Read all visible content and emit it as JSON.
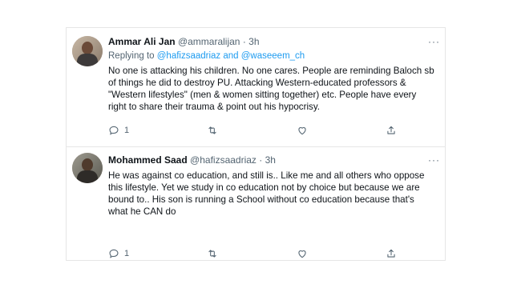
{
  "tweets": [
    {
      "name": "Ammar Ali Jan",
      "handle": "@ammaralijan",
      "dot": "·",
      "time": "3h",
      "reply_prefix": "Replying to",
      "reply_users": "@hafizsaadriaz and @waseeem_ch",
      "text": "No one is attacking his children. No one cares. People are reminding Baloch sb of things he did to destroy PU. Attacking Western-educated professors & \"Western lifestyles\" (men & women sitting together) etc. People have every right to share their trauma & point out his hypocrisy.",
      "reply_count": "1",
      "more": "···",
      "icons": [
        "reply-icon",
        "retweet-icon",
        "like-icon",
        "share-icon"
      ]
    },
    {
      "name": "Mohammed Saad",
      "handle": "@hafizsaadriaz",
      "dot": "·",
      "time": "3h",
      "text": "He was against co education, and still is.. Like me and all others who oppose this lifestyle. Yet we study in co education not by choice but because we are bound to.. His son is running a School without co education because that's what he CAN do",
      "reply_count": "1",
      "more": "···",
      "icons": [
        "reply-icon",
        "retweet-icon",
        "like-icon",
        "share-icon"
      ]
    }
  ],
  "colors": {
    "link": "#1d9bf0",
    "muted": "#536471",
    "text": "#0f1419",
    "border": "#e6e6e6"
  }
}
